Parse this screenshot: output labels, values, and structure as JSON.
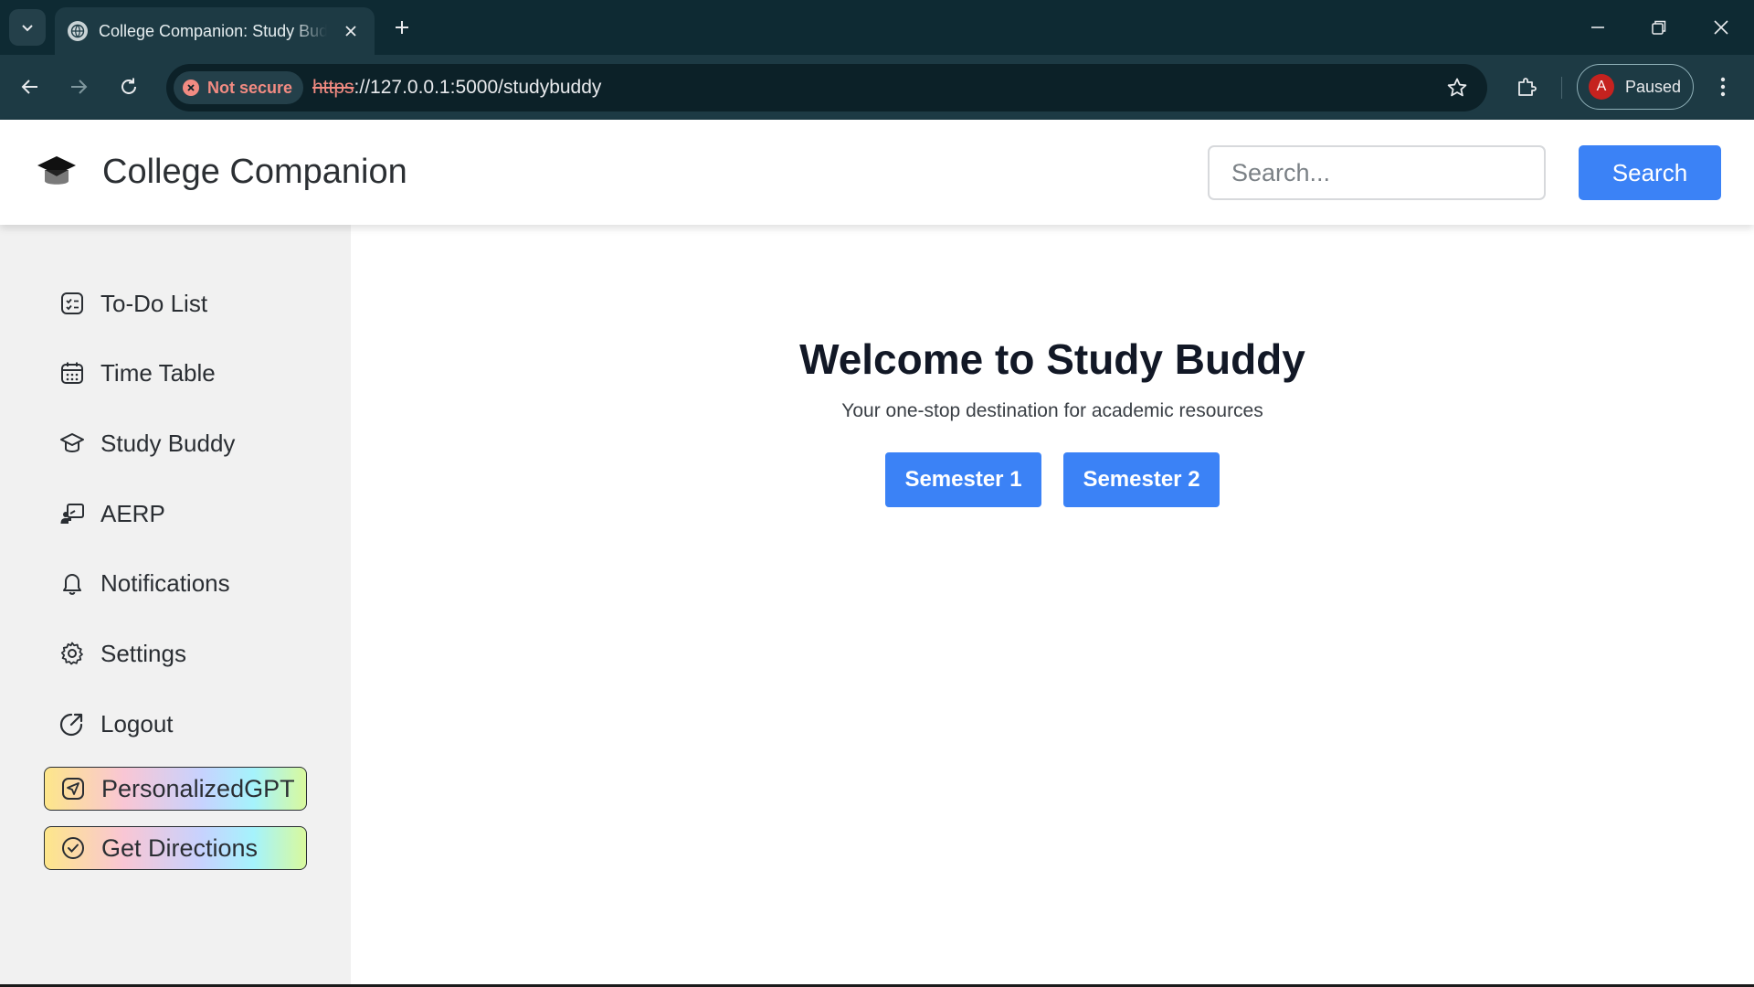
{
  "browser": {
    "tab_title": "College Companion: Study Buddy",
    "not_secure": "Not secure",
    "url_scheme": "https",
    "url_rest": "://127.0.0.1:5000/studybuddy",
    "profile_initial": "A",
    "profile_status": "Paused"
  },
  "header": {
    "title": "College Companion",
    "search_placeholder": "Search...",
    "search_button": "Search"
  },
  "sidebar": {
    "items": [
      {
        "label": "To-Do List",
        "icon": "checklist-icon"
      },
      {
        "label": "Time Table",
        "icon": "calendar-icon"
      },
      {
        "label": "Study Buddy",
        "icon": "graduation-cap-icon"
      },
      {
        "label": "AERP",
        "icon": "teacher-board-icon"
      },
      {
        "label": "Notifications",
        "icon": "bell-icon"
      },
      {
        "label": "Settings",
        "icon": "gear-icon"
      },
      {
        "label": "Logout",
        "icon": "logout-icon"
      }
    ],
    "highlights": [
      {
        "label": "PersonalizedGPT",
        "icon": "send-icon"
      },
      {
        "label": "Get Directions",
        "icon": "check-circle-icon"
      }
    ]
  },
  "main": {
    "heading": "Welcome to Study Buddy",
    "tagline": "Your one-stop destination for academic resources",
    "buttons": [
      "Semester 1",
      "Semester 2"
    ]
  },
  "colors": {
    "primary": "#3b82f6",
    "chrome_dark": "#0e2a33",
    "sidebar_bg": "#f1f1f1"
  }
}
